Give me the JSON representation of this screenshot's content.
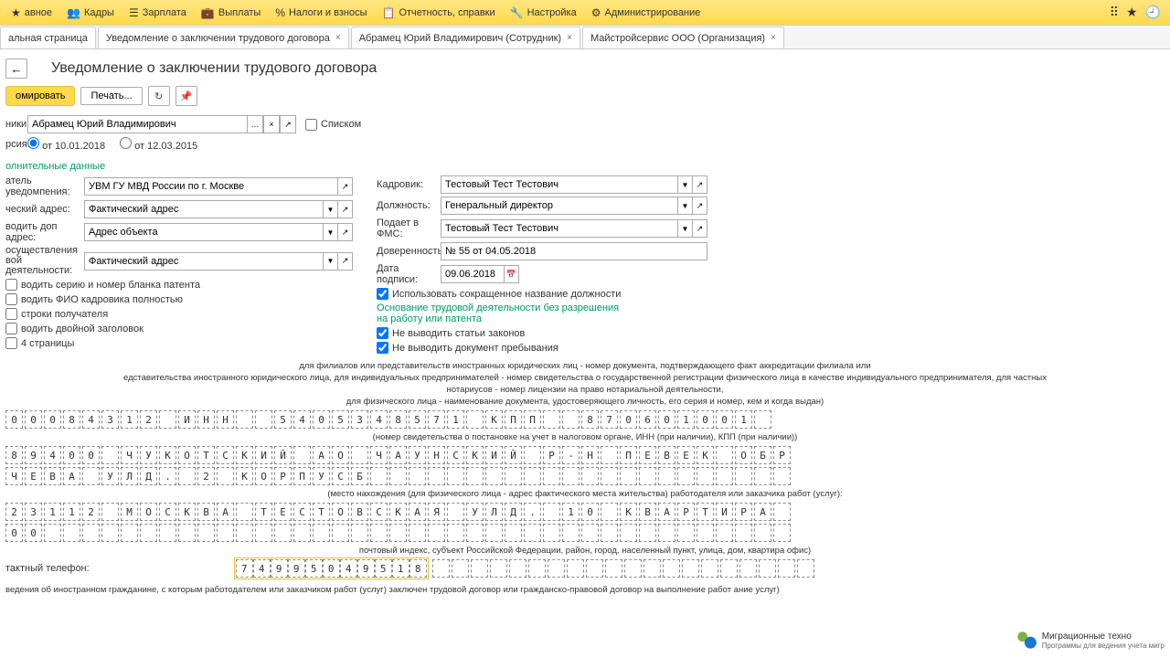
{
  "topbar": {
    "items": [
      {
        "label": "авное",
        "icon": "★"
      },
      {
        "label": "Кадры",
        "icon": "👥"
      },
      {
        "label": "Зарплата",
        "icon": "☰"
      },
      {
        "label": "Выплаты",
        "icon": "💼"
      },
      {
        "label": "Налоги и взносы",
        "icon": "%"
      },
      {
        "label": "Отчетность, справки",
        "icon": "📋"
      },
      {
        "label": "Настройка",
        "icon": "🔧"
      },
      {
        "label": "Администрирование",
        "icon": "⚙"
      }
    ]
  },
  "tabs": [
    {
      "label": "альная страница"
    },
    {
      "label": "Уведомление о заключении трудового договора"
    },
    {
      "label": "Абрамец Юрий Владимирович (Сотрудник)"
    },
    {
      "label": "Майстройсервис ООО (Организация)"
    }
  ],
  "page_title": "Уведомление о заключении трудового договора",
  "actions": {
    "form": "омировать",
    "print": "Печать..."
  },
  "employee": {
    "label": "ники:",
    "value": "Абрамец Юрий Владимирович",
    "list": "Списком"
  },
  "version": {
    "label": "рсия:",
    "opt1": "от 10.01.2018",
    "opt2": "от 12.03.2015"
  },
  "section1": "олнительные данные",
  "left": {
    "sender": {
      "label": "атель уведомпения:",
      "value": "УВМ ГУ МВД России по г. Москве"
    },
    "addr": {
      "label": "ческий адрес:",
      "value": "Фактический адрес"
    },
    "addaddr": {
      "label": "водить доп адрес:",
      "value": "Адрес объекта"
    },
    "actaddr": {
      "label": "осуществления вой деятельности:",
      "value": "Фактический адрес"
    },
    "chk1": "водить серию и номер бланка патента",
    "chk2": "водить ФИО кадровика полностью",
    "chk3": "строки получателя",
    "chk4": "водить двойной заголовок",
    "chk5": "4 страницы"
  },
  "right": {
    "hr": {
      "label": "Кадровик:",
      "value": "Тестовый Тест Тестович"
    },
    "pos": {
      "label": "Должность:",
      "value": "Генеральный директор"
    },
    "fms": {
      "label": "Подает в ФМС:",
      "value": "Тестовый Тест Тестович"
    },
    "att": {
      "label": "Доверенность:",
      "value": "№ 55 от 04.05.2018"
    },
    "sig": {
      "label": "Дата подписи:",
      "value": "09.06.2018"
    },
    "chk1": "Использовать сокращенное название должности",
    "green": "Основание трудовой деятельности без разрешения на работу или патента",
    "chk2": "Не выводить статьи законов",
    "chk3": "Не выводить документ пребывания"
  },
  "print": {
    "l1": "для филиалов или представительств иностранных юридических лиц - номер документа, подтверждающего факт аккредитации филиала или",
    "l2": "едставительства иностранного юридического лица, для индивидуальных предпринимателей - номер свидетельства о государственной регистрации физического лица в качестве индивидуального предпринимателя, для частных",
    "l3": "нотариусов - номер лицензии на право нотариальной деятельности,",
    "l4": "для физического лица - наименование документа, удостоверяющего личность, его серия и номер, кем и когда выдан)",
    "note1": "(номер свидетельства о постановке на учет в налоговом органе, ИНН (при наличии), КПП (при наличии))",
    "note2": "(место нахождения (для физического лица - адрес фактического места жительства) работодателя или заказчика работ (услуг):",
    "note3": "почтовый индекс, субъект Российской Федерации, район, город, населенный пункт, улица, дом, квартира офис)",
    "phone_label": "тактный телефон:",
    "footer": "ведения об иностранном гражданине, с которым работодателем или заказчиком работ (услуг) заключен трудовой договор или гражданско-правовой договор на выполнение работ ание услуг)"
  },
  "cells": {
    "r1": [
      "0",
      "0",
      "0",
      "8",
      "4",
      "3",
      "1",
      "2",
      "",
      "И",
      "Н",
      "Н",
      "",
      "",
      "5",
      "4",
      "0",
      "5",
      "3",
      "4",
      "8",
      "5",
      "7",
      "1",
      "",
      "К",
      "П",
      "П",
      "",
      "",
      "8",
      "7",
      "0",
      "6",
      "0",
      "1",
      "0",
      "0",
      "1",
      ""
    ],
    "r2": [
      "8",
      "9",
      "4",
      "0",
      "0",
      "",
      "Ч",
      "У",
      "К",
      "О",
      "Т",
      "С",
      "К",
      "И",
      "Й",
      "",
      "А",
      "О",
      "",
      "Ч",
      "А",
      "У",
      "Н",
      "С",
      "К",
      "И",
      "Й",
      "",
      "Р",
      "-",
      "Н",
      "",
      "П",
      "Е",
      "В",
      "Е",
      "К",
      "",
      "О",
      "Б",
      "Р"
    ],
    "r3": [
      "Ч",
      "Е",
      "В",
      "А",
      "",
      "У",
      "Л",
      "Д",
      ".",
      "",
      "2",
      "",
      "К",
      "О",
      "Р",
      "П",
      "У",
      "С",
      "Б",
      "",
      "",
      "",
      "",
      "",
      "",
      "",
      "",
      "",
      "",
      "",
      "",
      "",
      "",
      "",
      "",
      "",
      "",
      "",
      "",
      "",
      ""
    ],
    "r4": [
      "2",
      "3",
      "1",
      "1",
      "2",
      "",
      "М",
      "О",
      "С",
      "К",
      "В",
      "А",
      "",
      "Т",
      "Е",
      "С",
      "Т",
      "О",
      "В",
      "С",
      "К",
      "А",
      "Я",
      "",
      "У",
      "Л",
      "Д",
      ".",
      "",
      "1",
      "0",
      "",
      "К",
      "В",
      "А",
      "Р",
      "Т",
      "И",
      "Р",
      "А",
      ""
    ],
    "r5": [
      "0",
      "0",
      "",
      "",
      "",
      "",
      "",
      "",
      "",
      "",
      "",
      "",
      "",
      "",
      "",
      "",
      "",
      "",
      "",
      "",
      "",
      "",
      "",
      "",
      "",
      "",
      "",
      "",
      "",
      "",
      "",
      "",
      "",
      "",
      "",
      "",
      "",
      "",
      "",
      "",
      ""
    ],
    "phone": [
      "7",
      "4",
      "9",
      "9",
      "5",
      "0",
      "4",
      "9",
      "5",
      "1",
      "8"
    ],
    "phone_empty": [
      "",
      "",
      "",
      "",
      "",
      "",
      "",
      "",
      "",
      "",
      "",
      "",
      "",
      "",
      "",
      "",
      "",
      "",
      "",
      ""
    ]
  },
  "logo": {
    "title": "Миграционные техно",
    "sub": "Программы для ведения учета мигр"
  }
}
